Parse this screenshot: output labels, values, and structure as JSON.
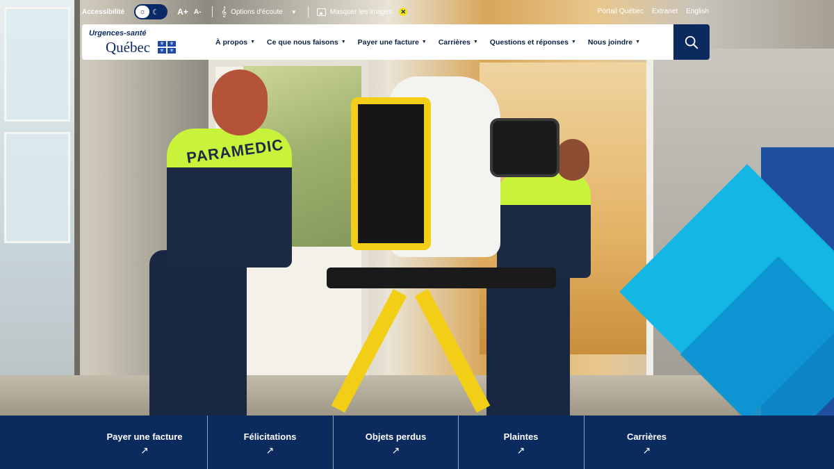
{
  "utility": {
    "accessibility_label": "Accessibilité",
    "font_increase": "A+",
    "font_decrease": "A-",
    "listen_label": "Options d'écoute",
    "hide_images_label": "Masquer les images",
    "links": [
      "Portail Québec",
      "Extranet",
      "English"
    ]
  },
  "brand": {
    "line1": "Urgences-santé",
    "line2": "Québec"
  },
  "nav": {
    "items": [
      "À propos",
      "Ce que nous faisons",
      "Payer une facture",
      "Carrières",
      "Questions et réponses",
      "Nous joindre"
    ]
  },
  "hero": {
    "vest_text": "PARAMEDIC"
  },
  "quick_links": {
    "items": [
      "Payer une facture",
      "Félicitations",
      "Objets perdus",
      "Plaintes",
      "Carrières"
    ],
    "arrow": "↗"
  },
  "colors": {
    "navy": "#0b2a5e",
    "accent_yellow": "#f2e21a",
    "geo_light_blue": "#14b6e3",
    "geo_dark_blue": "#1f4f9f"
  },
  "icons": {
    "search": "search-icon",
    "sun": "sun-icon",
    "moon": "moon-icon",
    "ear": "ear-icon",
    "image": "image-icon",
    "close": "close-icon"
  }
}
